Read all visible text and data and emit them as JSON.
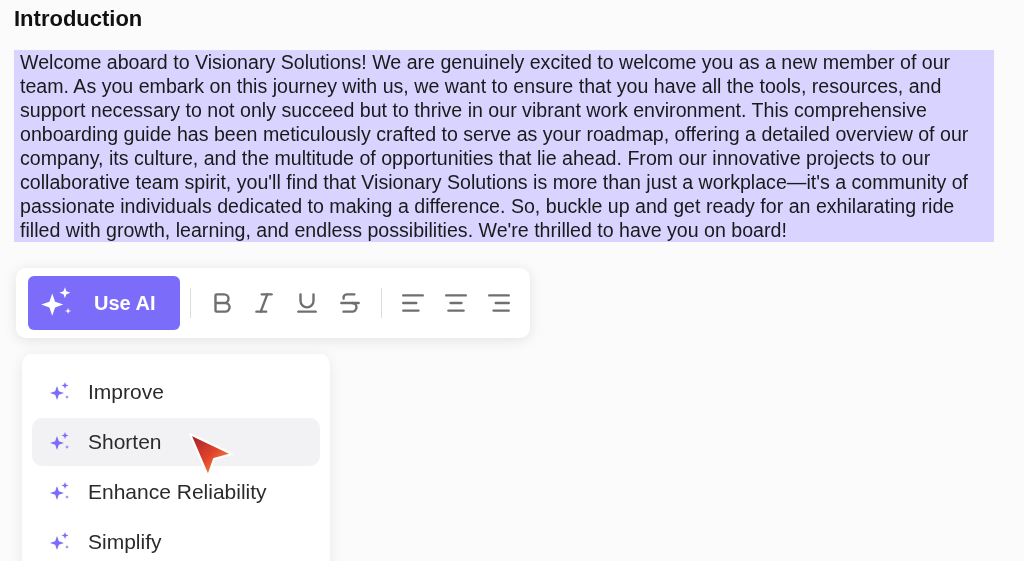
{
  "heading": "Introduction",
  "paragraph": {
    "text": "Welcome aboard to Visionary Solutions! We are genuinely excited to welcome you as a new member of our team. As you embark on this journey with us, we want to ensure that you have all the tools, resources, and support necessary to not only succeed but to thrive in our vibrant work environment. This comprehensive onboarding guide has been meticulously crafted to serve as your roadmap, offering a detailed overview of our company, its culture, and the multitude of opportunities that lie ahead. From our innovative projects to our collaborative team spirit, you'll find that Visionary Solutions is more than just a workplace—it's a community of passionate individuals dedicated to making a difference. So, buckle up and get ready for an exhilarating ride filled with growth, learning, and endless possibilities. We're thrilled to have you on board!",
    "selected": true
  },
  "toolbar": {
    "ai_button": "Use AI",
    "groups": [
      [
        {
          "kind": "bold"
        },
        {
          "kind": "italic"
        },
        {
          "kind": "underline"
        },
        {
          "kind": "strikethrough"
        }
      ],
      [
        {
          "kind": "align-left"
        },
        {
          "kind": "align-center"
        },
        {
          "kind": "align-right"
        }
      ]
    ]
  },
  "ai_menu": [
    {
      "label": "Improve",
      "selected": false
    },
    {
      "label": "Shorten",
      "selected": true
    },
    {
      "label": "Enhance Reliability",
      "selected": false
    },
    {
      "label": "Simplify",
      "selected": false
    }
  ]
}
